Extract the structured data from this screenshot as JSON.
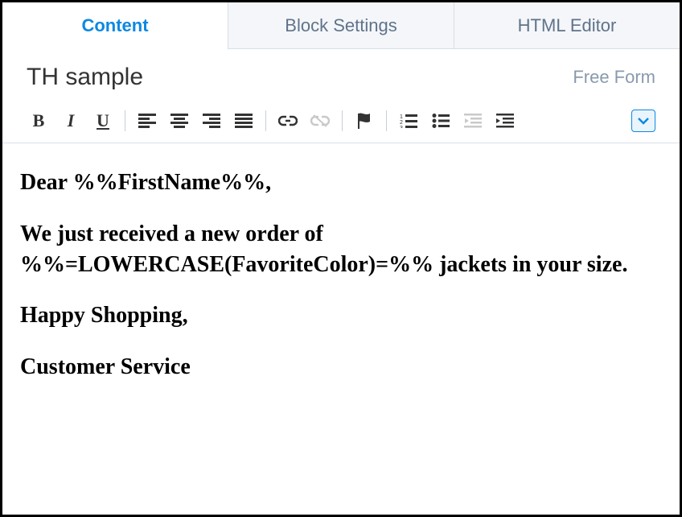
{
  "tabs": {
    "content": "Content",
    "block": "Block Settings",
    "html": "HTML Editor"
  },
  "header": {
    "title": "TH sample",
    "type": "Free Form"
  },
  "toolbar": {
    "bold": "B",
    "italic": "I",
    "underline": "U"
  },
  "body": {
    "p1": "Dear %%FirstName%%,",
    "p2": "We just received a new order of %%=LOWERCASE(FavoriteColor)=%% jackets in your size.",
    "p3": "Happy Shopping,",
    "p4": "Customer Service"
  }
}
